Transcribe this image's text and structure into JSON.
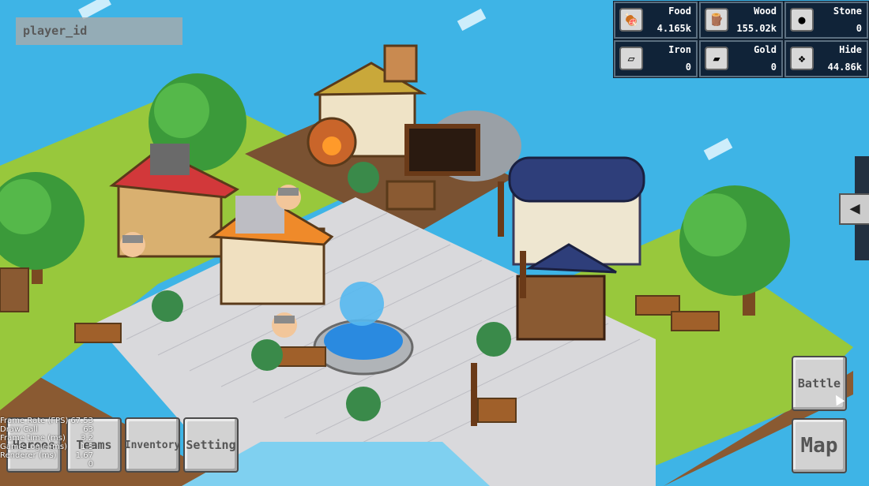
{
  "player": {
    "id_placeholder": "player_id"
  },
  "resources": [
    {
      "name": "Food",
      "value": "4.165k",
      "icon": "meat-icon",
      "glyph": "🍖"
    },
    {
      "name": "Wood",
      "value": "155.02k",
      "icon": "log-icon",
      "glyph": "🪵"
    },
    {
      "name": "Stone",
      "value": "0",
      "icon": "stone-icon",
      "glyph": "●"
    },
    {
      "name": "Iron",
      "value": "0",
      "icon": "iron-bar-icon",
      "glyph": "▱"
    },
    {
      "name": "Gold",
      "value": "0",
      "icon": "gold-bar-icon",
      "glyph": "▰"
    },
    {
      "name": "Hide",
      "value": "44.86k",
      "icon": "hide-icon",
      "glyph": "❖"
    }
  ],
  "side_tab": {
    "glyph": "◀"
  },
  "buttons": {
    "heroes": "Heroes",
    "teams": "Teams",
    "inventory": "Inventory",
    "setting": "Setting",
    "battle": "Battle",
    "map": "Map"
  },
  "debug_stats": [
    {
      "label": "Frame Rate (FPS)",
      "value": "67.53"
    },
    {
      "label": "Draw Call",
      "value": "63"
    },
    {
      "label": "Frame time (ms)",
      "value": "3.2"
    },
    {
      "label": "Game Logic (ms)",
      "value": "1.5"
    },
    {
      "label": "Renderer (ms)",
      "value": "1.67"
    },
    {
      "label": "",
      "value": "0"
    }
  ],
  "colors": {
    "sea": "#3eb4e6",
    "grass": "#98c83c",
    "pavement": "#d8d8d8",
    "dirt": "#7a5232",
    "panel": "#0f1e2e"
  }
}
